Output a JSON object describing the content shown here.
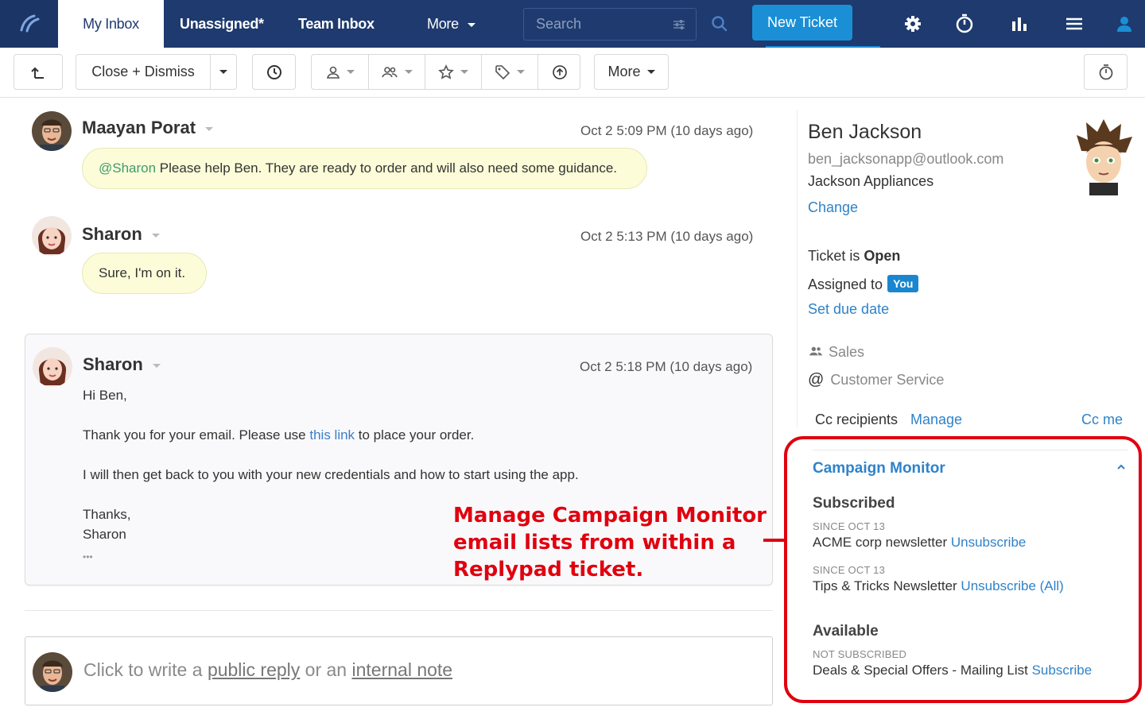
{
  "nav": {
    "tabs": [
      "My Inbox",
      "Unassigned*",
      "Team Inbox",
      "More"
    ],
    "search_placeholder": "Search",
    "new_ticket": "New Ticket",
    "icons": [
      "search-icon",
      "gear-icon",
      "timer-icon",
      "bar-chart-icon",
      "menu-icon",
      "user-icon"
    ]
  },
  "toolbar": {
    "close_dismiss": "Close + Dismiss",
    "more": "More"
  },
  "messages": [
    {
      "author": "Maayan Porat",
      "time": "Oct 2 5:09 PM (10 days ago)",
      "mention": "@Sharon",
      "text": " Please help Ben. They are ready to order and will also need some guidance."
    },
    {
      "author": "Sharon",
      "time": "Oct 2 5:13 PM (10 days ago)",
      "text": "Sure, I'm on  it."
    }
  ],
  "email": {
    "author": "Sharon",
    "time": "Oct 2 5:18 PM (10 days ago)",
    "greeting": "Hi Ben,",
    "line1_pre": "Thank you for your email. Please use ",
    "line1_link": "this link",
    "line1_post": " to place your order.",
    "line2": "I will then get back to you with your new credentials and how to start using the app.",
    "signoff1": "Thanks,",
    "signoff2": "Sharon",
    "ellipsis": "•••"
  },
  "annotation": {
    "line1": "Manage Campaign Monitor",
    "line2": "email lists from within a",
    "line3": "Replypad ticket."
  },
  "reply": {
    "prefix": "Click to write a ",
    "public": "public reply",
    "middle": " or an ",
    "internal": "internal note"
  },
  "contact": {
    "name": "Ben Jackson",
    "email": "ben_jacksonapp@outlook.com",
    "company": "Jackson Appliances",
    "change": "Change",
    "ticket_is": "Ticket is ",
    "status": "Open",
    "assigned_to": "Assigned to",
    "assignee": "You",
    "set_due": "Set due date",
    "group": "Sales",
    "channel": "Customer Service",
    "cc_label": "Cc recipients",
    "cc_manage": "Manage",
    "cc_me": "Cc me"
  },
  "campaign": {
    "title": "Campaign Monitor",
    "subscribed_heading": "Subscribed",
    "lists": [
      {
        "since": "SINCE OCT 13",
        "name": "ACME corp newsletter",
        "action": "Unsubscribe"
      },
      {
        "since": "SINCE OCT 13",
        "name": "Tips & Tricks Newsletter",
        "action": "Unsubscribe (All)"
      }
    ],
    "available_heading": "Available",
    "available": {
      "status": "NOT SUBSCRIBED",
      "name": "Deals & Special Offers - Mailing List",
      "action": "Subscribe"
    }
  },
  "colors": {
    "nav_bg": "#1e3a6e",
    "accent": "#1a8fd6",
    "link": "#2f82c9",
    "annotation": "#e0000f",
    "bubble": "#fcfcd8"
  }
}
